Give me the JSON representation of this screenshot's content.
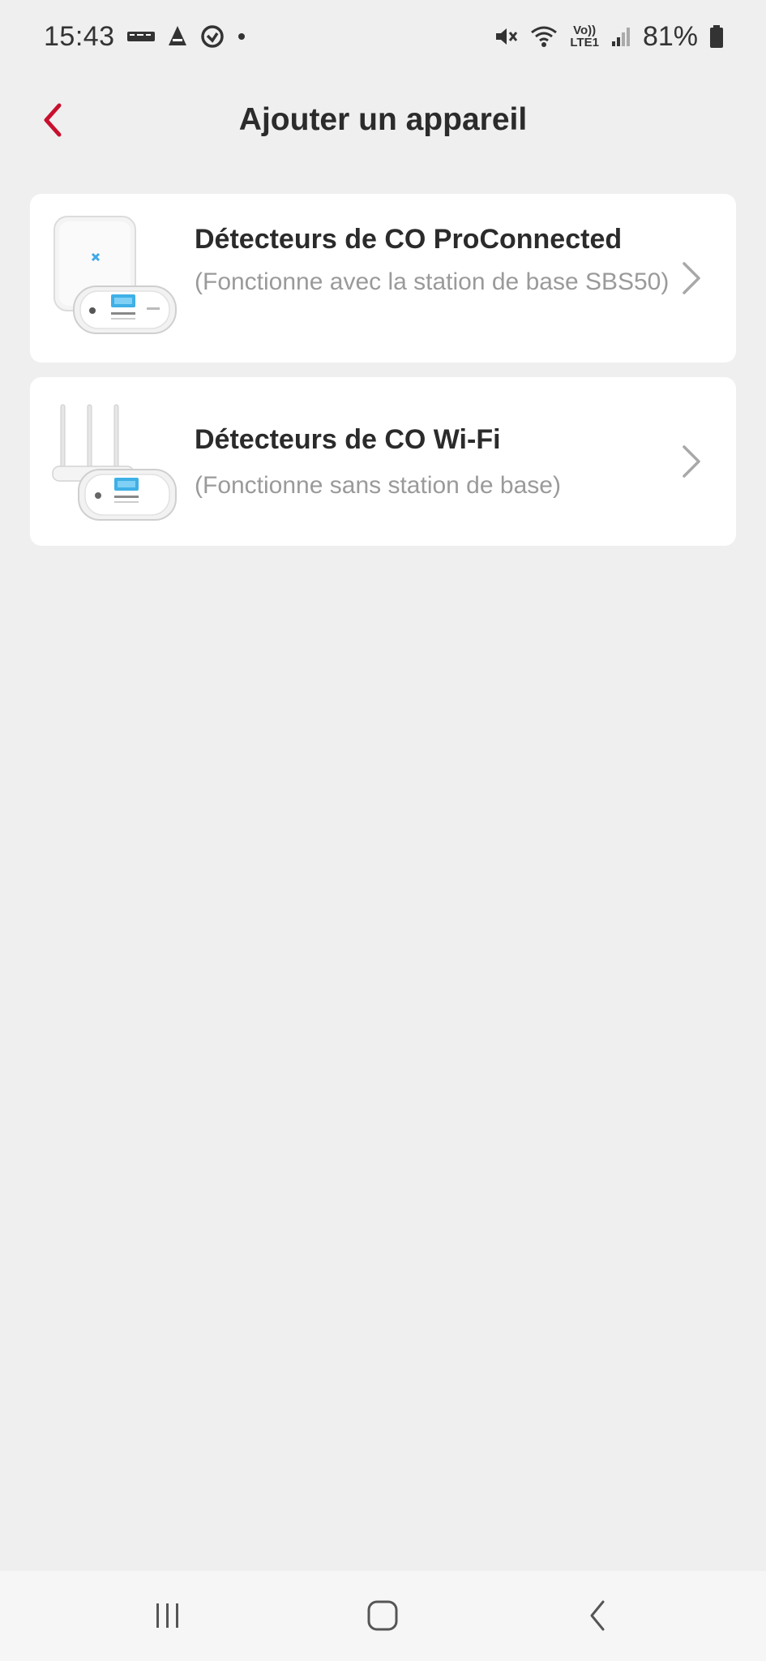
{
  "status_bar": {
    "time": "15:43",
    "left_icons": [
      "carrier-7eleven-icon",
      "app-notification-icon",
      "activity-icon",
      "dot-icon"
    ],
    "volte_label_top": "Vo))",
    "volte_label_bottom": "LTE1",
    "right_icons": [
      "mute-icon",
      "wifi-icon",
      "volte-icon",
      "signal-icon",
      "battery-icon"
    ],
    "battery": "81%"
  },
  "header": {
    "title": "Ajouter un appareil",
    "back_icon": "chevron-left-icon"
  },
  "devices": [
    {
      "title": "Détecteurs de CO ProConnected",
      "subtitle": "(Fonctionne avec la station de base SBS50)"
    },
    {
      "title": "Détecteurs de CO Wi-Fi",
      "subtitle": "(Fonctionne sans station de base)"
    }
  ],
  "navigation": {
    "icons": [
      "recent-apps-icon",
      "home-icon",
      "back-icon"
    ]
  },
  "colors": {
    "accent": "#c8102e",
    "background": "#efefef",
    "card": "#ffffff",
    "title_text": "#2b2b2b",
    "subtitle_text": "#9a9a9a",
    "chevron": "#a8a8a8",
    "screen_blue": "#3fb0e6"
  }
}
